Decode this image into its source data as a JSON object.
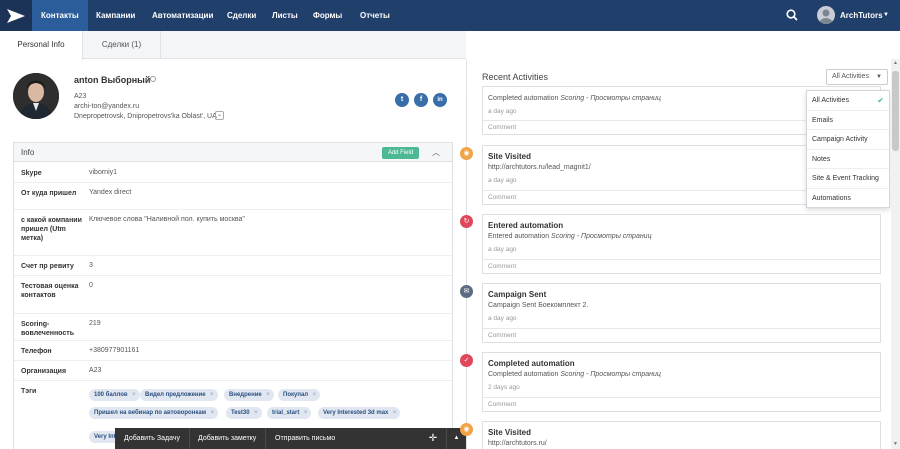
{
  "nav": {
    "items": [
      "Контакты",
      "Кампании",
      "Автоматизации",
      "Сделки",
      "Листы",
      "Формы",
      "Отчеты"
    ],
    "user_name": "ArchTutors"
  },
  "tabs": [
    "Personal Info",
    "Сделки (1)"
  ],
  "profile": {
    "name": "anton Выборный",
    "company": "A23",
    "email": "archi-ton@yandex.ru",
    "location": "Dnepropetrovsk, Dnipropetrovs'ka Oblast', UA",
    "social": [
      "t",
      "f",
      "in"
    ]
  },
  "info": {
    "title": "Info",
    "add_field": "Add Field",
    "rows": [
      {
        "label": "Skype",
        "value": "viborniy1"
      },
      {
        "label": "От куда пришел",
        "value": "Yandex direct"
      },
      {
        "label": "с какой компании пришел (Utm метка)",
        "value": "Ключевое слова \"Наливной пол. купить москва\""
      },
      {
        "label": "Счет пр ревиту",
        "value": "3"
      },
      {
        "label": "Тестовая оценка контактов",
        "value": "0"
      },
      {
        "label": "Scoring- вовлеченность",
        "value": "219"
      },
      {
        "label": "Телефон",
        "value": "+380977901161"
      },
      {
        "label": "Организация",
        "value": "A23"
      },
      {
        "label": "Тэги",
        "value": ""
      }
    ],
    "tags": [
      "100 баллов",
      "Видел предложение",
      "Внедрение",
      "Покупал",
      "Пришел на вебинар по автоворонкам",
      "Test30",
      "trial_start",
      "Very Interested 3d max",
      "Very Int"
    ]
  },
  "bottom_bar": {
    "add_task": "Добавить Задачу",
    "add_note": "Добавить заметку",
    "send_email": "Отправить письмо"
  },
  "activities": {
    "title": "Recent Activities",
    "filter_label": "All Activities",
    "dropdown": [
      "All Activities",
      "Emails",
      "Campaign Activity",
      "Notes",
      "Site & Event Tracking",
      "Automations"
    ],
    "cards": [
      {
        "title": "",
        "desc": "Completed automation Scoring - Просмотры страниц",
        "time": "a day ago",
        "comment": "Comment"
      },
      {
        "title": "Site Visited",
        "desc": "http://archtutors.ru/lead_magnit1/",
        "time": "a day ago",
        "comment": "Comment"
      },
      {
        "title": "Entered automation",
        "desc": "Entered automation Scoring - Просмотры страниц",
        "time": "a day ago",
        "comment": "Comment"
      },
      {
        "title": "Campaign Sent",
        "desc": "Campaign Sent Боекомплект 2.",
        "time": "a day ago",
        "comment": "Comment"
      },
      {
        "title": "Completed automation",
        "desc": "Completed automation Scoring - Просмотры страниц",
        "time": "2 days ago",
        "comment": "Comment"
      },
      {
        "title": "Site Visited",
        "desc": "http://archtutors.ru/",
        "time": "",
        "comment": ""
      }
    ]
  },
  "colors": {
    "nav_bg": "#213f6b",
    "nav_active": "#2a5d99",
    "accent_green": "#4cb894",
    "icon_orange": "#f0a347",
    "icon_red": "#e0475b",
    "icon_slate": "#5b6b82"
  }
}
